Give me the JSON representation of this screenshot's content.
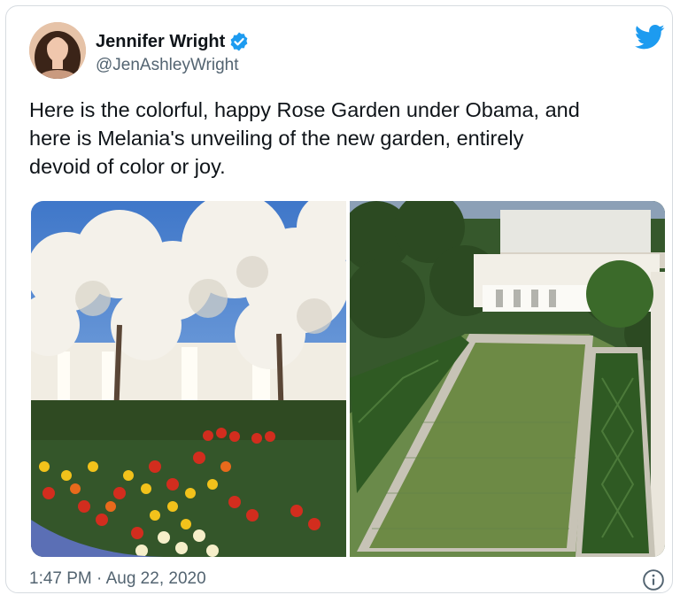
{
  "tweet": {
    "author_name": "Jennifer Wright",
    "author_handle": "@JenAshleyWright",
    "text": "Here is the colorful, happy Rose Garden under Obama, and\nhere is Melania's unveiling of the new garden, entirely\ndevoid of color or joy.",
    "timestamp": "1:47 PM · Aug 22, 2020"
  },
  "icons": {
    "verified": "verified-badge-icon",
    "brand": "twitter-bird-icon",
    "info": "info-icon"
  },
  "colors": {
    "brand_blue": "#1d9bf0",
    "text_primary": "#0f1419",
    "text_secondary": "#536471"
  }
}
